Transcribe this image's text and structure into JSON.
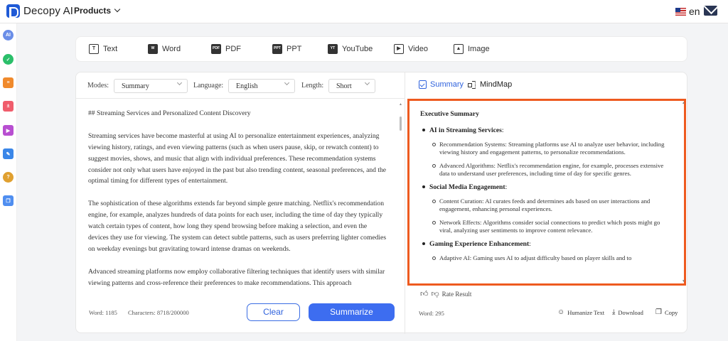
{
  "header": {
    "brand": "Decopy AI",
    "products_label": "Products",
    "lang_label": "en"
  },
  "rail": {
    "items": [
      "AI",
      "chat",
      "list",
      "math",
      "video",
      "edit",
      "help",
      "copy"
    ]
  },
  "toolbar": {
    "tools": [
      {
        "label": "Text",
        "icon": "T"
      },
      {
        "label": "Word",
        "icon": "W"
      },
      {
        "label": "PDF",
        "icon": "PDF"
      },
      {
        "label": "PPT",
        "icon": "PPT"
      },
      {
        "label": "YouTube",
        "icon": "YT"
      },
      {
        "label": "Video",
        "icon": "▶"
      },
      {
        "label": "Image",
        "icon": "▲"
      }
    ]
  },
  "options": {
    "modes_label": "Modes:",
    "modes_value": "Summary",
    "language_label": "Language:",
    "language_value": "English",
    "length_label": "Length:",
    "length_value": "Short"
  },
  "source": {
    "paragraphs": [
      "## Streaming Services and Personalized Content Discovery",
      "Streaming services have become masterful at using AI to personalize entertainment experiences, analyzing viewing history, ratings, and even viewing patterns (such as when users pause, skip, or rewatch content) to suggest movies, shows, and music that align with individual preferences. These recommendation systems consider not only what users have enjoyed in the past but also trending content, seasonal preferences, and the optimal timing for different types of entertainment.",
      "The sophistication of these algorithms extends far beyond simple genre matching. Netflix's recommendation engine, for example, analyzes hundreds of data points for each user, including the time of day they typically watch certain types of content, how long they spend browsing before making a selection, and even the devices they use for viewing. The system can detect subtle patterns, such as users preferring lighter comedies on weekday evenings but gravitating toward intense dramas on weekends.",
      "Advanced streaming platforms now employ collaborative filtering techniques that identify users with similar viewing patterns and cross-reference their preferences to make recommendations. This approach"
    ],
    "word_count": "Word: 1185",
    "char_count": "Characters: 8718/200000",
    "clear_label": "Clear",
    "summarize_label": "Summarize"
  },
  "result": {
    "tab_summary": "Summary",
    "tab_mindmap": "MindMap",
    "title": "Executive Summary",
    "sections": [
      {
        "heading": "AI in Streaming Services",
        "items": [
          "Recommendation Systems: Streaming platforms use AI to analyze user behavior, including viewing history and engagement patterns, to personalize recommendations.",
          "Advanced Algorithms: Netflix's recommendation engine, for example, processes extensive data to understand user preferences, including time of day for specific genres."
        ]
      },
      {
        "heading": "Social Media Engagement",
        "items": [
          "Content Curation: AI curates feeds and determines ads based on user interactions and engagement, enhancing personal experiences.",
          "Network Effects: Algorithms consider social connections to predict which posts might go viral, analyzing user sentiments to improve content relevance."
        ]
      },
      {
        "heading": "Gaming Experience Enhancement",
        "items": [
          "Adaptive AI: Gaming uses AI to adjust difficulty based on player skills and to"
        ]
      }
    ],
    "rate_label": "Rate Result",
    "word_count": "Word: 295",
    "humanize_label": "Humanize Text",
    "download_label": "Download",
    "copy_label": "Copy",
    "highlight_color": "#ee5a1f"
  }
}
